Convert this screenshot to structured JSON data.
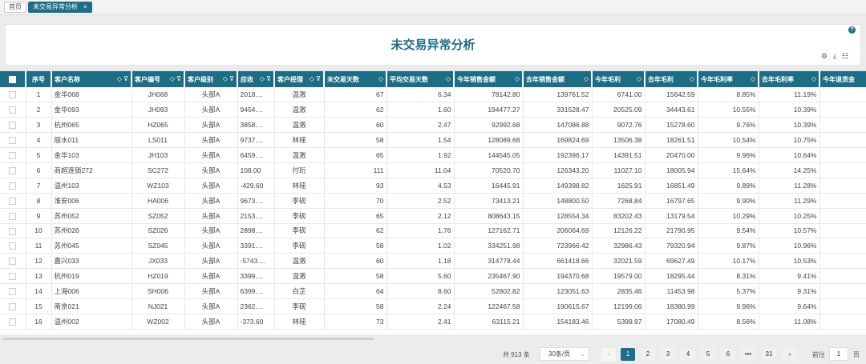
{
  "tabs": [
    {
      "label": "首页"
    },
    {
      "label": "未交易异常分析",
      "close": "×"
    }
  ],
  "page_title": "未交易异常分析",
  "help_label": "?",
  "toolbar": {
    "icons": [
      "settings-icon",
      "download-icon",
      "column-list-icon"
    ]
  },
  "table": {
    "columns": [
      {
        "label": "序号"
      },
      {
        "label": "客户名称",
        "icons": "◇ ⊽"
      },
      {
        "label": "客户编号",
        "icons": "◇ ⊽"
      },
      {
        "label": "客户级别",
        "icons": "◇ ⊽"
      },
      {
        "label": "应收",
        "icons": "◇ ⊽"
      },
      {
        "label": "客户经理",
        "icons": "◇ ⊽"
      },
      {
        "label": "未交易天数",
        "icons": "◇"
      },
      {
        "label": "平均交易天数",
        "icons": "◇"
      },
      {
        "label": "今年销售金额",
        "icons": "◇"
      },
      {
        "label": "去年销售金额",
        "icons": "◇"
      },
      {
        "label": "今年毛利",
        "icons": "◇"
      },
      {
        "label": "去年毛利",
        "icons": "◇"
      },
      {
        "label": "今年毛利率",
        "icons": "◇"
      },
      {
        "label": "去年毛利率",
        "icons": "◇"
      },
      {
        "label": "今年退货金",
        "icons": ""
      }
    ],
    "rows": [
      [
        "1",
        "金华068",
        "JH068",
        "头部A",
        "2018....",
        "温激",
        "67",
        "6.34",
        "78142.80",
        "139761.52",
        "6741.00",
        "15642.59",
        "8.85%",
        "11.19%",
        ""
      ],
      [
        "2",
        "金华093",
        "JH093",
        "头部A",
        "9454....",
        "温激",
        "62",
        "1.60",
        "194477.27",
        "331528.47",
        "20525.09",
        "34443.61",
        "10.55%",
        "10.39%",
        ""
      ],
      [
        "3",
        "杭州065",
        "HZ065",
        "头部A",
        "3858....",
        "温激",
        "60",
        "2.47",
        "92992.68",
        "147086.88",
        "9072.76",
        "15278.60",
        "9.76%",
        "10.39%",
        ""
      ],
      [
        "4",
        "丽水011",
        "LS011",
        "头部A",
        "9737....",
        "林瑶",
        "58",
        "1.54",
        "128089.68",
        "169824.69",
        "13506.38",
        "18261.51",
        "10.54%",
        "10.75%",
        ""
      ],
      [
        "5",
        "金华103",
        "JH103",
        "头部A",
        "6459....",
        "温激",
        "65",
        "1.92",
        "144545.05",
        "192396.17",
        "14391.51",
        "20470.00",
        "9.96%",
        "10.64%",
        ""
      ],
      [
        "6",
        "商超连锁272",
        "SC272",
        "头部A",
        "108.00",
        "付珩",
        "111",
        "11.04",
        "70520.70",
        "126343.20",
        "11027.10",
        "18005.94",
        "15.64%",
        "14.25%",
        ""
      ],
      [
        "7",
        "温州103",
        "WZ103",
        "头部A",
        "-429.60",
        "林瑶",
        "93",
        "4.53",
        "16445.91",
        "149398.82",
        "1625.91",
        "16851.49",
        "9.89%",
        "11.28%",
        ""
      ],
      [
        "8",
        "淮安006",
        "HA006",
        "头部A",
        "9673....",
        "李砚",
        "70",
        "2.52",
        "73413.21",
        "148800.50",
        "7268.84",
        "16797.65",
        "9.90%",
        "11.29%",
        ""
      ],
      [
        "9",
        "苏州052",
        "SZ052",
        "头部A",
        "2153....",
        "李砚",
        "65",
        "2.12",
        "808643.15",
        "128554.34",
        "83202.43",
        "13179.54",
        "10.29%",
        "10.25%",
        ""
      ],
      [
        "10",
        "苏州026",
        "SZ026",
        "头部A",
        "2898....",
        "李砚",
        "62",
        "1.76",
        "127162.71",
        "206064.69",
        "12126.22",
        "21790.95",
        "9.54%",
        "10.57%",
        ""
      ],
      [
        "11",
        "苏州045",
        "SZ045",
        "头部A",
        "3391....",
        "李砚",
        "58",
        "1.02",
        "334251.98",
        "723966.42",
        "32986.43",
        "79320.94",
        "9.87%",
        "10.96%",
        ""
      ],
      [
        "12",
        "嘉兴033",
        "JX033",
        "头部A",
        "-5743....",
        "温激",
        "60",
        "1.18",
        "314778.44",
        "661418.66",
        "32021.59",
        "69627.49",
        "10.17%",
        "10.53%",
        ""
      ],
      [
        "13",
        "杭州019",
        "HZ019",
        "头部A",
        "3399....",
        "温激",
        "58",
        "5.60",
        "235467.90",
        "194370.68",
        "19579.00",
        "18295.44",
        "8.31%",
        "9.41%",
        ""
      ],
      [
        "14",
        "上海006",
        "SH006",
        "头部A",
        "6399....",
        "白芷",
        "64",
        "8.60",
        "52802.82",
        "123051.63",
        "2835.46",
        "11453.98",
        "5.37%",
        "9.31%",
        ""
      ],
      [
        "15",
        "南京021",
        "NJ021",
        "头部A",
        "2362....",
        "李砚",
        "58",
        "2.24",
        "122467.58",
        "190615.67",
        "12199.06",
        "18380.99",
        "9.96%",
        "9.64%",
        ""
      ],
      [
        "16",
        "温州002",
        "WZ002",
        "头部A",
        "-373.60",
        "林瑶",
        "73",
        "2.41",
        "63115.21",
        "154183.46",
        "5399.97",
        "17080.49",
        "8.56%",
        "11.08%",
        ""
      ]
    ]
  },
  "pagination": {
    "total": "共 913 条",
    "page_size": "30条/页",
    "prev": "‹",
    "pages": [
      "1",
      "2",
      "3",
      "4",
      "5",
      "6",
      "•••",
      "31"
    ],
    "current": "1",
    "next": "›",
    "goto_label": "前往",
    "goto_value": "1",
    "goto_unit": "页"
  }
}
